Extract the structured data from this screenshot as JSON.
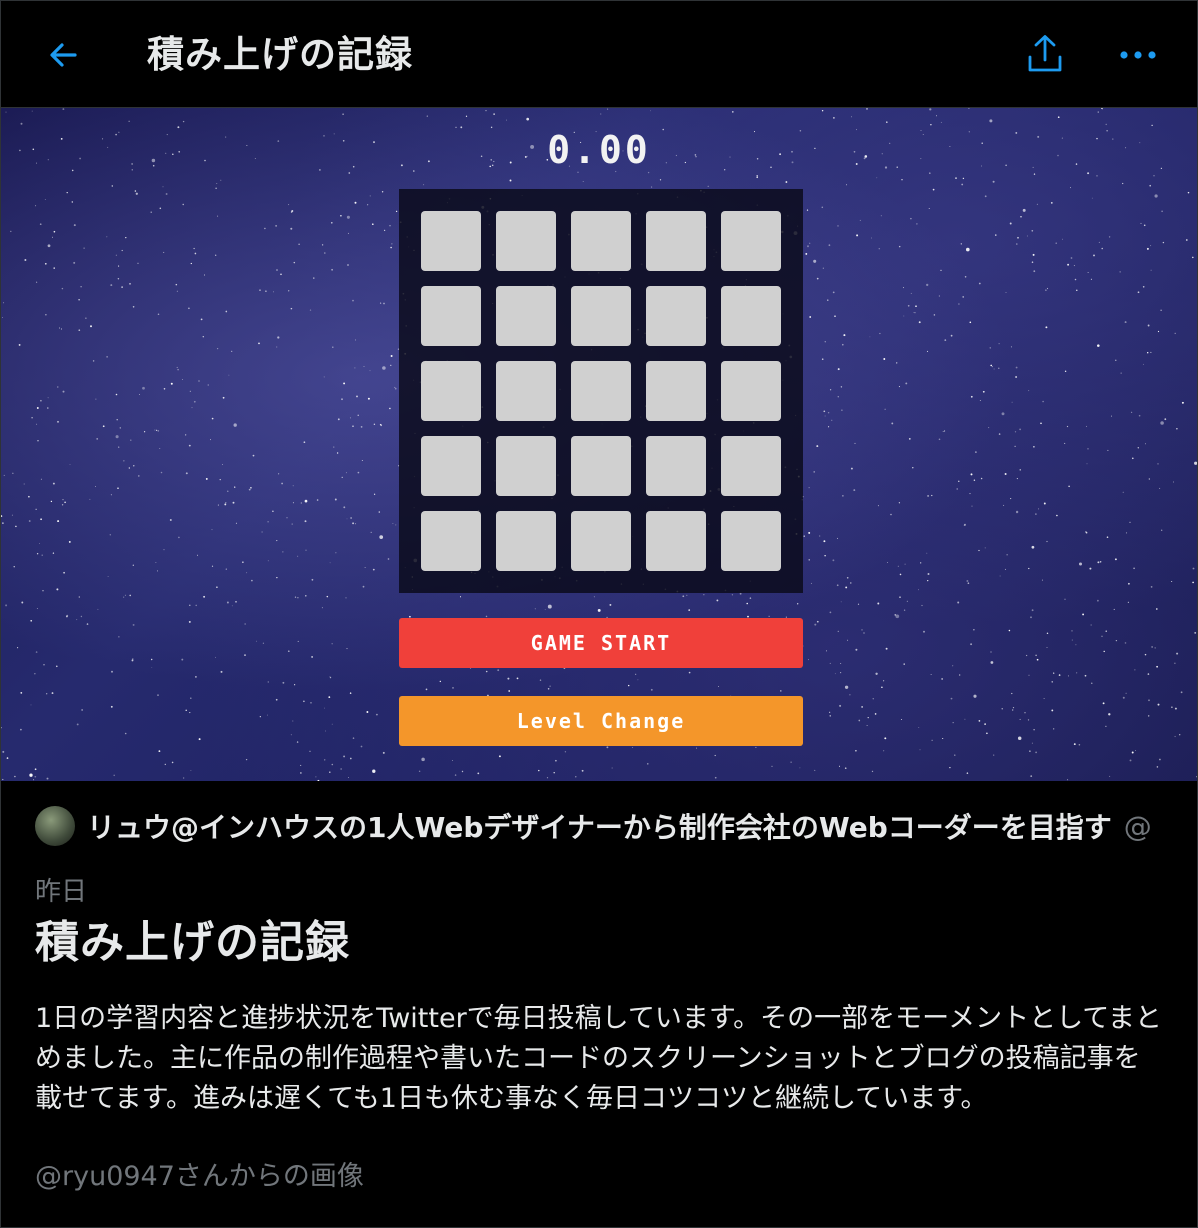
{
  "header": {
    "title": "積み上げの記録",
    "back_icon": "arrow-left-icon",
    "share_icon": "share-icon",
    "more_icon": "more-horizontal-icon",
    "accent_color": "#1d9bf0"
  },
  "hero": {
    "game": {
      "timer": "0.00",
      "grid_rows": 5,
      "grid_cols": 5,
      "cell_color": "#d0d0d0",
      "start_button": "GAME START",
      "start_color": "#f0403a",
      "level_button": "Level Change",
      "level_color": "#f4962a"
    }
  },
  "author": {
    "name": "リュウ@インハウスの1人Webデザイナーから制作会社のWebコーダーを目指す",
    "handle": "@"
  },
  "moment": {
    "date": "昨日",
    "title": "積み上げの記録",
    "description": "1日の学習内容と進捗状況をTwitterで毎日投稿しています。その一部をモーメントとしてまとめました。主に作品の制作過程や書いたコードのスクリーンショットとブログの投稿記事を載せてます。進みは遅くても1日も休む事なく毎日コツコツと継続しています。",
    "credit": "@ryu0947さんからの画像"
  }
}
